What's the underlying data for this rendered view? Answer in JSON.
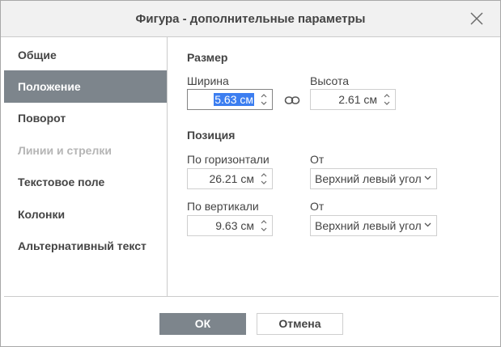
{
  "dialog": {
    "title": "Фигура - дополнительные параметры",
    "close_icon": "close-icon"
  },
  "sidebar": {
    "items": [
      {
        "label": "Общие",
        "state": "normal"
      },
      {
        "label": "Положение",
        "state": "active"
      },
      {
        "label": "Поворот",
        "state": "normal"
      },
      {
        "label": "Линии и стрелки",
        "state": "disabled"
      },
      {
        "label": "Текстовое поле",
        "state": "normal"
      },
      {
        "label": "Колонки",
        "state": "normal"
      },
      {
        "label": "Альтернативный текст",
        "state": "normal"
      }
    ]
  },
  "size": {
    "title": "Размер",
    "width_label": "Ширина",
    "width_value": "5.63 см",
    "height_label": "Высота",
    "height_value": "2.61 см",
    "aspect_lock_icon": "link-icon"
  },
  "position": {
    "title": "Позиция",
    "horizontal_label": "По горизонтали",
    "horizontal_value": "26.21 см",
    "horizontal_from_label": "От",
    "horizontal_from_value": "Верхний левый угол",
    "vertical_label": "По вертикали",
    "vertical_value": "9.63 см",
    "vertical_from_label": "От",
    "vertical_from_value": "Верхний левый угол"
  },
  "footer": {
    "ok_label": "ОК",
    "cancel_label": "Отмена"
  },
  "colors": {
    "accent": "#7d858c",
    "selection": "#3c7ef0",
    "title_bar": "#f1f1f1"
  }
}
